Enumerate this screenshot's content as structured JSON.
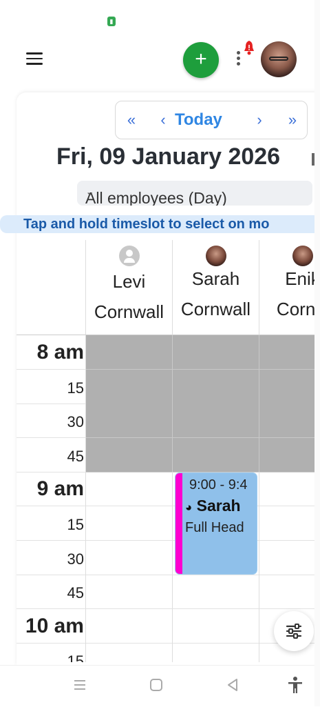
{
  "status": {
    "battery_icon": "battery-icon"
  },
  "appbar": {
    "menu_icon": "hamburger-menu-icon",
    "add_label": "+",
    "more_icon": "more-vertical-icon",
    "bell_icon": "bell-notification-icon",
    "avatar_icon": "user-avatar"
  },
  "nav": {
    "first": "«",
    "prev": "‹",
    "today": "Today",
    "next": "›",
    "last": "»"
  },
  "date_title": "Fri, 09 January 2026",
  "employee_select": {
    "value": "All employees (Day)"
  },
  "hint": "Tap and hold timeslot to select on mo",
  "employees": [
    {
      "first": "Levi",
      "last": "Cornwall",
      "avatar": "generic"
    },
    {
      "first": "Sarah",
      "last": "Cornwall",
      "avatar": "photo"
    },
    {
      "first": "Enik",
      "last": "Cornw",
      "avatar": "photo"
    }
  ],
  "time_rows": [
    {
      "label": "8 am",
      "hour": true,
      "greyed": true
    },
    {
      "label": "15",
      "hour": false,
      "greyed": true
    },
    {
      "label": "30",
      "hour": false,
      "greyed": true
    },
    {
      "label": "45",
      "hour": false,
      "greyed": true
    },
    {
      "label": "9 am",
      "hour": true,
      "greyed": false
    },
    {
      "label": "15",
      "hour": false,
      "greyed": false
    },
    {
      "label": "30",
      "hour": false,
      "greyed": false
    },
    {
      "label": "45",
      "hour": false,
      "greyed": false
    },
    {
      "label": "10 am",
      "hour": true,
      "greyed": false
    },
    {
      "label": "15",
      "hour": false,
      "greyed": false
    }
  ],
  "appointment": {
    "time": "9:00 - 9:4",
    "client_icon": "pie-status-icon",
    "client": "Sarah",
    "service": "Full Head",
    "colors": {
      "bar": "#ff00d0",
      "fill": "#8fc0ea"
    }
  },
  "colors": {
    "accent_green": "#1e9e3c",
    "link_blue": "#2f86e3",
    "hint_bg": "#dcebfb",
    "grey_slot": "#b0b0b0"
  },
  "fab_icon": "filter-sliders-icon",
  "system_nav": {
    "recents": "recents-icon",
    "home": "home-icon",
    "back": "back-icon",
    "accessibility": "accessibility-icon"
  }
}
